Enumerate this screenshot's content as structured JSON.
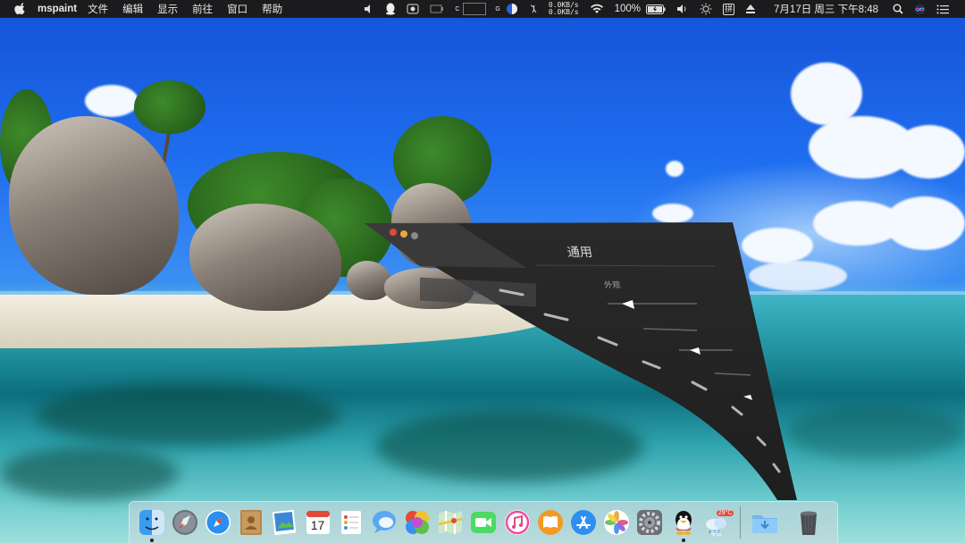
{
  "menubar": {
    "app_name": "mspaint",
    "menus": [
      "文件",
      "编辑",
      "显示",
      "前往",
      "窗口",
      "帮助"
    ],
    "network_up": "0.0KB/s",
    "network_down": "0.0KB/s",
    "battery_percent": "100%",
    "date_time": "7月17日 周三 下午8:48",
    "input_method": "拼",
    "gpu_label": "G",
    "cpu_label": "C",
    "status_icons": [
      "volume-mute-icon",
      "qq-icon",
      "screenshot-icon",
      "display-icon",
      "memory-icon",
      "moon-icon",
      "fan-icon",
      "wifi-icon",
      "battery-icon",
      "volume-icon",
      "brightness-icon",
      "eject-icon",
      "search-icon",
      "siri-icon",
      "notification-icon"
    ]
  },
  "genie_window": {
    "title": "通用",
    "subtitle": "外观"
  },
  "dock": {
    "apps": [
      {
        "name": "访达",
        "icon": "finder-icon",
        "running": true
      },
      {
        "name": "启动台",
        "icon": "launchpad-icon",
        "running": false
      },
      {
        "name": "Safari浏览器",
        "icon": "safari-icon",
        "running": false
      },
      {
        "name": "通讯录",
        "icon": "contacts-icon",
        "running": false
      },
      {
        "name": "预览",
        "icon": "preview-icon",
        "running": false
      },
      {
        "name": "日历",
        "icon": "calendar-icon",
        "running": false
      },
      {
        "name": "提醒事项",
        "icon": "reminders-icon",
        "running": false
      },
      {
        "name": "信息",
        "icon": "messages-icon",
        "running": false
      },
      {
        "name": "照片流",
        "icon": "photo-booth-icon",
        "running": false
      },
      {
        "name": "地图",
        "icon": "maps-icon",
        "running": false
      },
      {
        "name": "FaceTime",
        "icon": "facetime-icon",
        "running": false
      },
      {
        "name": "iTunes",
        "icon": "itunes-icon",
        "running": false
      },
      {
        "name": "图书",
        "icon": "books-icon",
        "running": false
      },
      {
        "name": "App Store",
        "icon": "app-store-icon",
        "running": false
      },
      {
        "name": "照片",
        "icon": "photos-icon",
        "running": false
      },
      {
        "name": "系统偏好设置",
        "icon": "system-preferences-icon",
        "running": false
      },
      {
        "name": "QQ",
        "icon": "qq-icon",
        "running": true
      },
      {
        "name": "天气",
        "icon": "weather-icon",
        "running": false
      }
    ],
    "calendar_day": "17",
    "weather_temp": "29°C",
    "weather_label": "多云",
    "trash": "废纸篓",
    "downloads": "下载"
  },
  "colors": {
    "menubar_bg": "#1b1b1d",
    "window_bg": "#2a2a2a",
    "dock_bg": "#d2d7dc"
  }
}
